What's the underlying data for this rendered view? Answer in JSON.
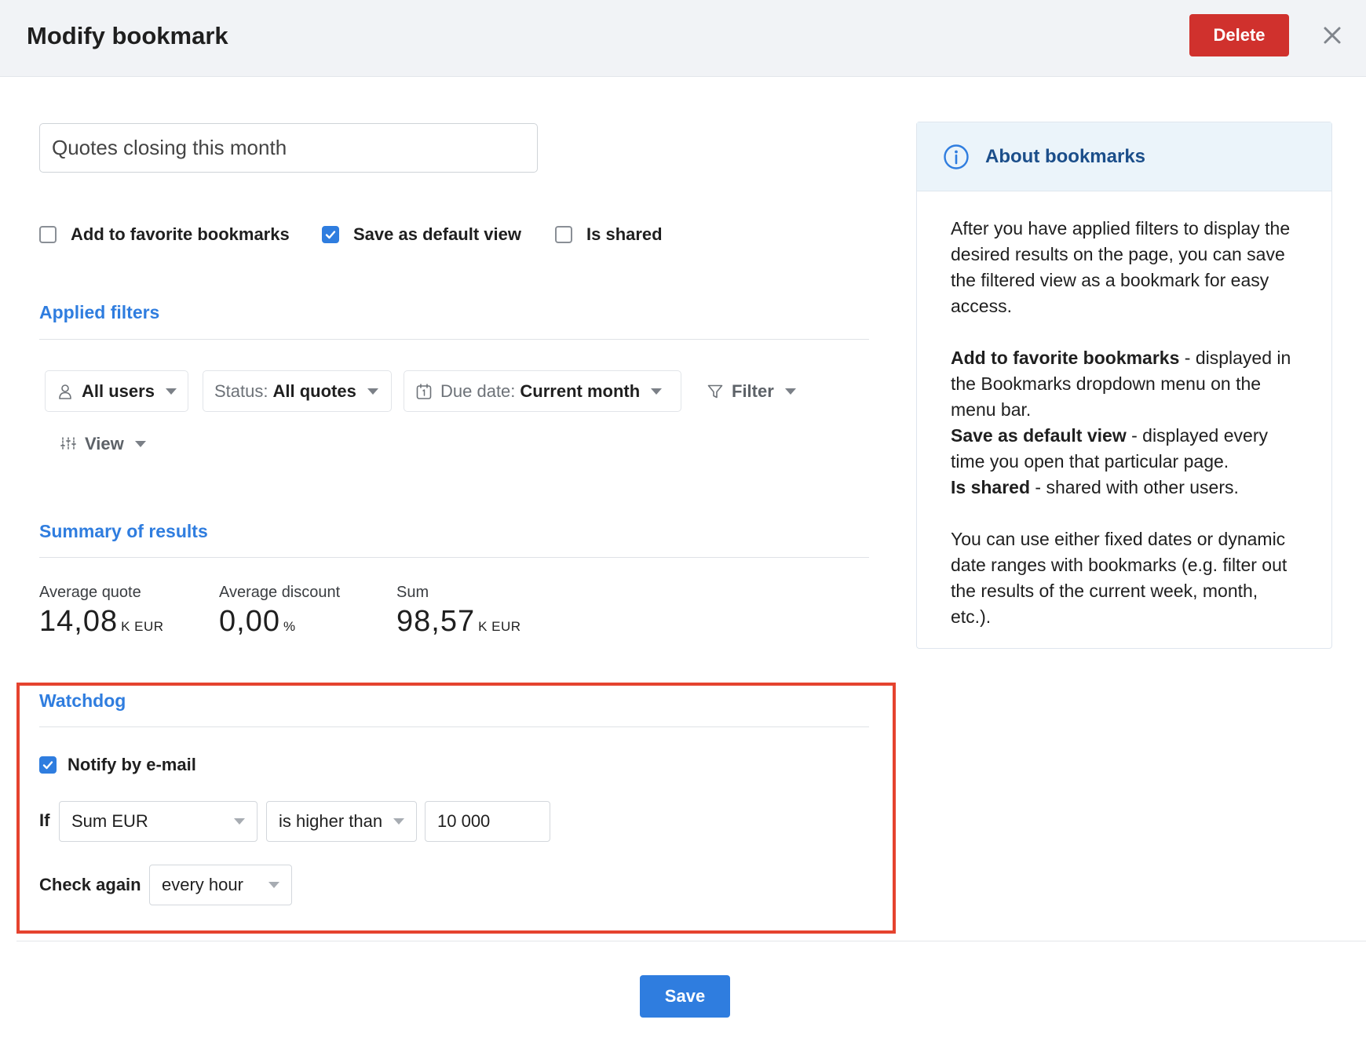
{
  "header": {
    "title": "Modify bookmark",
    "delete_label": "Delete",
    "close_icon": "close-icon"
  },
  "bookmark": {
    "name": "Quotes closing this month",
    "options": [
      {
        "label": "Add to favorite bookmarks",
        "checked": false
      },
      {
        "label": "Save as default view",
        "checked": true
      },
      {
        "label": "Is shared",
        "checked": false
      }
    ]
  },
  "applied_filters": {
    "title": "Applied filters",
    "chips": [
      {
        "icon": "user-icon",
        "prefix": "",
        "value": "All users"
      },
      {
        "icon": "",
        "prefix": "Status:",
        "value": "All quotes"
      },
      {
        "icon": "calendar-icon",
        "prefix": "Due date:",
        "value": "Current month"
      },
      {
        "icon": "filter-icon",
        "prefix": "",
        "value": "Filter"
      },
      {
        "icon": "sliders-icon",
        "prefix": "",
        "value": "View"
      }
    ]
  },
  "summary": {
    "title": "Summary of results",
    "stats": [
      {
        "label": "Average quote",
        "value": "14,08",
        "unit": "K EUR"
      },
      {
        "label": "Average discount",
        "value": "0,00",
        "unit": "%"
      },
      {
        "label": "Sum",
        "value": "98,57",
        "unit": "K EUR"
      }
    ]
  },
  "watchdog": {
    "title": "Watchdog",
    "notify_label": "Notify by e-mail",
    "notify_checked": true,
    "if_label": "If",
    "field": "Sum EUR",
    "operator": "is higher than",
    "threshold": "10 000",
    "check_again_label": "Check again",
    "frequency": "every hour"
  },
  "footer": {
    "save_label": "Save"
  },
  "info": {
    "icon": "info-icon",
    "title": "About bookmarks",
    "intro": "After you have applied filters to display the desired results on the page, you can save the filtered view as a bookmark for easy access.",
    "fav_term": "Add to favorite bookmarks",
    "fav_desc": " - displayed in the Bookmarks dropdown menu on the menu bar.",
    "default_term": "Save as default view",
    "default_desc": " - displayed every time you open that particular page.",
    "shared_term": "Is shared",
    "shared_desc": " - shared with other users.",
    "outro": "You can use either fixed dates or dynamic date ranges with bookmarks (e.g. filter out the results of the current week, month, etc.)."
  }
}
